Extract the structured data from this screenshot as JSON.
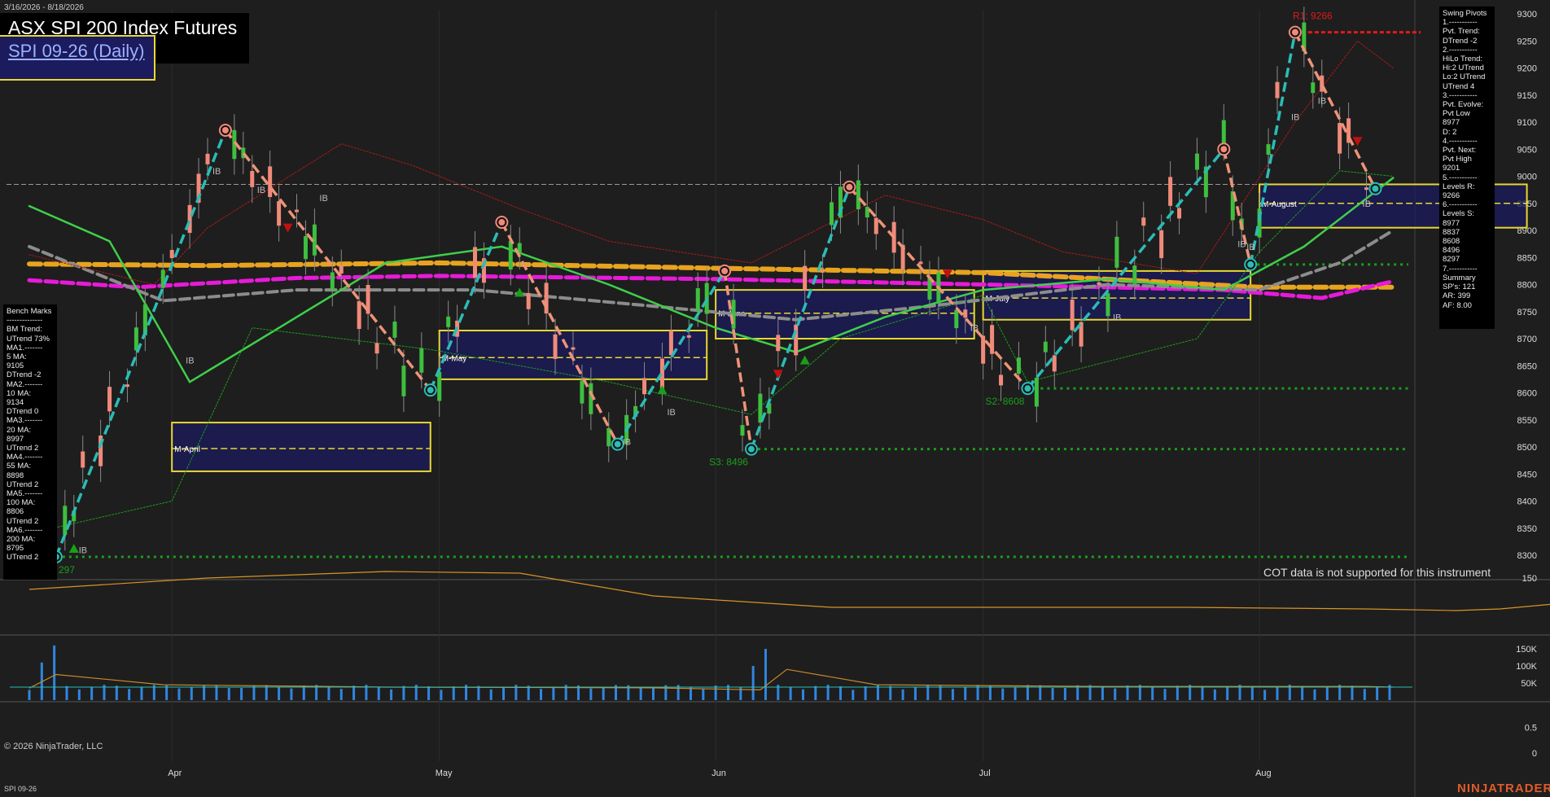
{
  "header": {
    "date_range": "3/16/2026 - 8/18/2026",
    "instrument": "ASX SPI 200 Index Futures",
    "contract": "SPI 09-26 (Daily)"
  },
  "swing_panel": {
    "lines": [
      "Swing Pivots",
      "1.-----------",
      "Pvt. Trend:",
      "DTrend -2",
      "2.-----------",
      "HiLo Trend:",
      "Hi:2 UTrend",
      "Lo:2 UTrend",
      "UTrend 4",
      "3.-----------",
      "Pvt. Evolve:",
      "Pvt Low",
      "8977",
      "D: 2",
      "4.-----------",
      "Pvt. Next:",
      "Pvt High",
      "9201",
      "5.-----------",
      "Levels R:",
      "9266",
      "6.-----------",
      "Levels S:",
      "8977",
      "8837",
      "8608",
      "8496",
      "8297",
      "7.-----------",
      "Summary",
      "SP's: 121",
      "AR: 399",
      "AF: 8.00"
    ]
  },
  "bench_panel": {
    "lines": [
      "Bench Marks",
      "--------------",
      "BM Trend:",
      "UTrend 73%",
      "MA1.-------",
      "5 MA:",
      "9105",
      "DTrend -2",
      "MA2.-------",
      "10 MA:",
      "9134",
      "DTrend 0",
      "MA3.-------",
      "20 MA:",
      "8997",
      "UTrend 2",
      "MA4.-------",
      "55 MA:",
      "8898",
      "UTrend 2",
      "MA5.-------",
      "100 MA:",
      "8806",
      "UTrend 2",
      "MA6.-------",
      "200 MA:",
      "8795",
      "UTrend 2"
    ]
  },
  "notes": {
    "cot": "COT data is not supported for this instrument",
    "copyright": "© 2026 NinjaTrader, LLC",
    "brand": "NINJATRADER",
    "footer_instrument": "SPI 09-26"
  },
  "colors": {
    "background": "#1e1e1e",
    "up_pivot_line": "#2bbcb6",
    "down_pivot_line": "#ee9377",
    "ma_orange": "#e8a41f",
    "ma_magenta": "#e81ad9",
    "ma_green": "#3fcf4a",
    "ma_gray": "#8c8c8c",
    "resistance": "#e01b1b",
    "support": "#1c9d1c",
    "box_border": "#e8d832",
    "box_fill": "#1b1b5e"
  },
  "chart_data": [
    {
      "type": "line",
      "title": "ASX SPI 200 Index Futures SPI 09-26 (Daily)",
      "x_labels": [
        "Apr",
        "May",
        "Jun",
        "Jul",
        "Aug"
      ],
      "y_ticks": [
        8300,
        8350,
        8400,
        8450,
        8500,
        8550,
        8600,
        8650,
        8700,
        8750,
        8800,
        8850,
        8900,
        8950,
        9000,
        9050,
        9100,
        9150,
        9200,
        9250,
        9300
      ],
      "ylim": [
        8275,
        9320
      ],
      "swing_pivots": [
        {
          "date": "2026-03-19",
          "price": 8297,
          "kind": "low"
        },
        {
          "date": "2026-04-07",
          "price": 9085,
          "kind": "high"
        },
        {
          "date": "2026-04-30",
          "price": 8605,
          "kind": "low"
        },
        {
          "date": "2026-05-08",
          "price": 8915,
          "kind": "high"
        },
        {
          "date": "2026-05-21",
          "price": 8505,
          "kind": "low"
        },
        {
          "date": "2026-06-02",
          "price": 8825,
          "kind": "high"
        },
        {
          "date": "2026-06-05",
          "price": 8496,
          "kind": "low"
        },
        {
          "date": "2026-06-16",
          "price": 8980,
          "kind": "high"
        },
        {
          "date": "2026-07-06",
          "price": 8608,
          "kind": "low"
        },
        {
          "date": "2026-07-28",
          "price": 9050,
          "kind": "high"
        },
        {
          "date": "2026-07-31",
          "price": 8837,
          "kind": "low"
        },
        {
          "date": "2026-08-05",
          "price": 9266,
          "kind": "high"
        },
        {
          "date": "2026-08-14",
          "price": 8977,
          "kind": "low"
        }
      ],
      "levels": [
        {
          "label": "R1: 9266",
          "price": 9266,
          "kind": "resistance"
        },
        {
          "label": "S2: 8608",
          "price": 8608,
          "kind": "support"
        },
        {
          "label": "S3: 8496",
          "price": 8496,
          "kind": "support"
        },
        {
          "label": "297",
          "price": 8297,
          "kind": "support"
        },
        {
          "label": "",
          "price": 8837,
          "kind": "support"
        }
      ],
      "monthly_boxes": [
        {
          "label": "M-April",
          "start": "2026-04-01",
          "end": "2026-04-30",
          "high": 8545,
          "low": 8455,
          "mid": 8497
        },
        {
          "label": "M-May",
          "start": "2026-05-01",
          "end": "2026-05-31",
          "high": 8715,
          "low": 8625,
          "mid": 8665
        },
        {
          "label": "M-June",
          "start": "2026-06-01",
          "end": "2026-06-30",
          "high": 8790,
          "low": 8700,
          "mid": 8747
        },
        {
          "label": "M-July",
          "start": "2026-07-01",
          "end": "2026-07-31",
          "high": 8825,
          "low": 8735,
          "mid": 8775
        },
        {
          "label": "M-August",
          "start": "2026-08-01",
          "end": "2026-08-31",
          "high": 8985,
          "low": 8905,
          "mid": 8950
        }
      ],
      "moving_averages": [
        {
          "name": "5 MA",
          "value": 9105
        },
        {
          "name": "10 MA",
          "value": 9134
        },
        {
          "name": "20 MA",
          "value": 8997
        },
        {
          "name": "55 MA",
          "value": 8898
        },
        {
          "name": "100 MA",
          "value": 8806
        },
        {
          "name": "200 MA",
          "value": 8795
        }
      ],
      "ib_markers": [
        "IB",
        "IB",
        "IB",
        "IB",
        "IB",
        "IB",
        "IB",
        "IB",
        "IB",
        "IB",
        "IB",
        "IB",
        "IB",
        "IB"
      ],
      "grid": false
    },
    {
      "type": "line",
      "title": "",
      "y_ticks": [
        150
      ],
      "ylim": [
        100,
        180
      ]
    },
    {
      "type": "bar",
      "title": "",
      "y_ticks": [
        50000,
        100000,
        150000
      ],
      "ylim": [
        0,
        180000
      ]
    },
    {
      "type": "line",
      "title": "",
      "y_ticks": [
        0,
        0.5
      ],
      "ylim": [
        -0.05,
        0.8
      ]
    }
  ]
}
